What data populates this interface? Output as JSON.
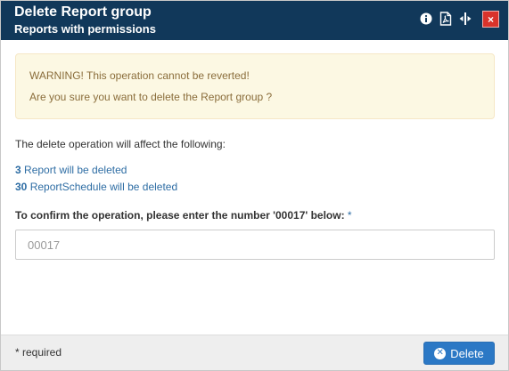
{
  "dialog": {
    "title": "Delete Report group",
    "subtitle": "Reports with permissions",
    "header_icons": [
      "info-icon",
      "pdf-icon",
      "resize-icon"
    ],
    "close_label": "×"
  },
  "warning": {
    "line1": "WARNING! This operation cannot be reverted!",
    "line2": "Are you sure you want to delete the Report group ?"
  },
  "affect_text": "The delete operation will affect the following:",
  "effects": [
    {
      "count": "3",
      "text": " Report will be deleted"
    },
    {
      "count": "30",
      "text": " ReportSchedule will be deleted"
    }
  ],
  "confirm": {
    "label": "To confirm the operation, please enter the number '00017' below:",
    "required_mark": " *",
    "placeholder": "00017",
    "value": ""
  },
  "footer": {
    "required_note": "* required",
    "delete_label": "Delete"
  },
  "colors": {
    "header_bg": "#11385a",
    "close_bg": "#d9332b",
    "warning_bg": "#fcf8e3",
    "warning_text": "#8a6d3b",
    "link": "#2e6da4",
    "primary_button": "#2b78c5"
  }
}
